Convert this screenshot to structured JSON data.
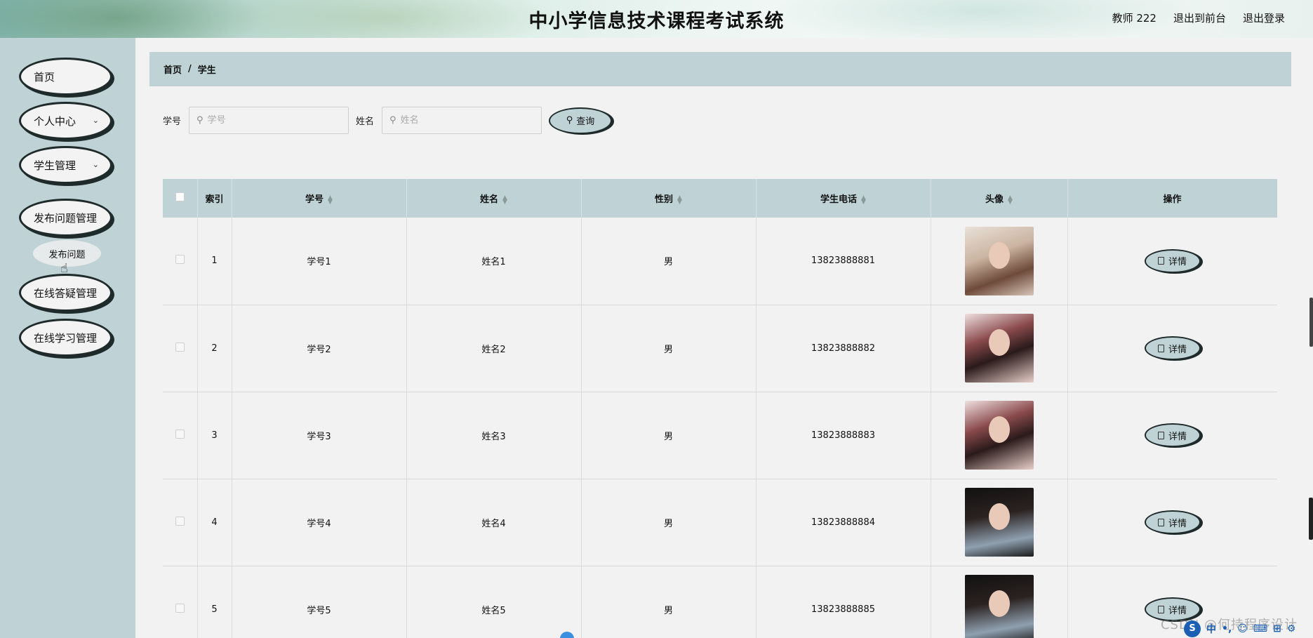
{
  "header": {
    "title": "中小学信息技术课程考试系统",
    "user": "教师 222",
    "exit_front": "退出到前台",
    "logout": "退出登录"
  },
  "sidebar": {
    "items": [
      {
        "label": "首页",
        "has_chevron": false
      },
      {
        "label": "个人中心",
        "has_chevron": true
      },
      {
        "label": "学生管理",
        "has_chevron": true
      },
      {
        "label": "发布问题管理",
        "has_chevron": false
      },
      {
        "label": "在线答疑管理",
        "has_chevron": false
      },
      {
        "label": "在线学习管理",
        "has_chevron": false
      }
    ],
    "sub_item": "发布问题"
  },
  "breadcrumb": {
    "home": "首页",
    "separator": "/",
    "current": "学生"
  },
  "search": {
    "student_id_label": "学号",
    "student_id_placeholder": "学号",
    "name_label": "姓名",
    "name_placeholder": "姓名",
    "query_button": "查询"
  },
  "table": {
    "headers": {
      "index": "索引",
      "student_id": "学号",
      "name": "姓名",
      "gender": "性别",
      "phone": "学生电话",
      "avatar": "头像",
      "actions": "操作"
    },
    "rows": [
      {
        "index": "1",
        "student_id": "学号1",
        "name": "姓名1",
        "gender": "男",
        "phone": "13823888881",
        "action": "详情"
      },
      {
        "index": "2",
        "student_id": "学号2",
        "name": "姓名2",
        "gender": "男",
        "phone": "13823888882",
        "action": "详情"
      },
      {
        "index": "3",
        "student_id": "学号3",
        "name": "姓名3",
        "gender": "男",
        "phone": "13823888883",
        "action": "详情"
      },
      {
        "index": "4",
        "student_id": "学号4",
        "name": "姓名4",
        "gender": "男",
        "phone": "13823888884",
        "action": "详情"
      },
      {
        "index": "5",
        "student_id": "学号5",
        "name": "姓名5",
        "gender": "男",
        "phone": "13823888885",
        "action": "详情"
      }
    ]
  },
  "watermark": "CSDN @何持程序设计",
  "tray": {
    "logo": "S",
    "icons": [
      "中",
      "•,",
      "☺",
      "⌨",
      "⊞",
      "⚙"
    ]
  },
  "colors": {
    "accent": "#bfd3d6",
    "button_border": "#1f2a2a",
    "background": "#f2f2f2"
  }
}
